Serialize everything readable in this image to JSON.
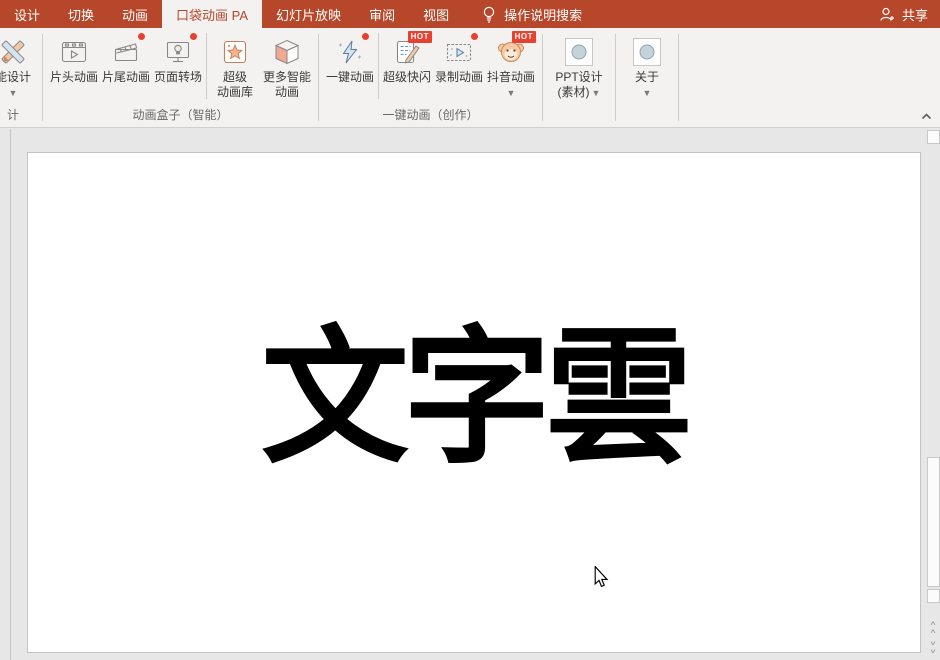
{
  "titlebar": {
    "bg_color": "#B7472A",
    "tabs": [
      {
        "label": "设计"
      },
      {
        "label": "切换"
      },
      {
        "label": "动画"
      },
      {
        "label": "口袋动画 PA"
      },
      {
        "label": "幻灯片放映"
      },
      {
        "label": "审阅"
      },
      {
        "label": "视图"
      }
    ],
    "tell_me": "操作说明搜索",
    "share_label": "共享"
  },
  "ribbon": {
    "hot_color": "#E8412F",
    "clipped": {
      "label": "能设计",
      "group_label": "计"
    },
    "group_a": {
      "label": "动画盒子（智能）",
      "b1": {
        "label": "片头动画"
      },
      "b2": {
        "label": "片尾动画"
      },
      "b3": {
        "label": "页面转场"
      },
      "b4": {
        "line1": "超级",
        "line2": "动画库"
      },
      "b5": {
        "line1": "更多智能",
        "line2": "动画"
      }
    },
    "group_b": {
      "label": "一键动画（创作）",
      "b1": {
        "label": "一键动画"
      },
      "b2": {
        "label": "超级快闪",
        "badge": "HOT"
      },
      "b3": {
        "label": "录制动画"
      },
      "b4": {
        "label": "抖音动画",
        "badge": "HOT"
      }
    },
    "ppt_design": {
      "line1": "PPT设计",
      "line2": "(素材)"
    },
    "about": {
      "label": "关于"
    }
  },
  "slide": {
    "text": "文字雲"
  }
}
